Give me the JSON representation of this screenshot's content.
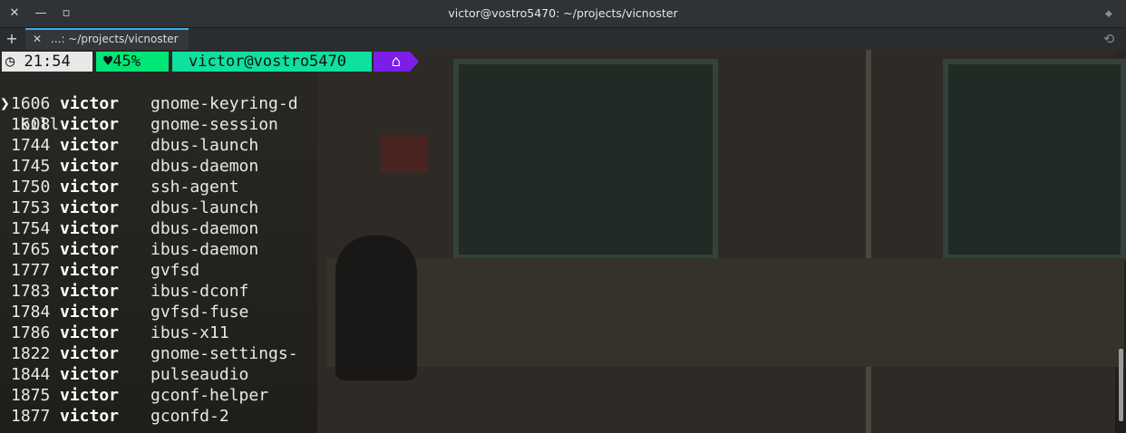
{
  "window": {
    "title": "victor@vostro5470: ~/projects/vicnoster",
    "close_glyph": "✕",
    "minimize_glyph": "—",
    "maximize_glyph": "▫",
    "menu_glyph": "⌖"
  },
  "tabs": {
    "new_tab_glyph": "+",
    "items": [
      {
        "label": "...: ~/projects/vicnoster",
        "close_glyph": "✕"
      }
    ],
    "history_glyph": "⟲"
  },
  "prompt": {
    "clock_glyph": "◷",
    "time": "21:54",
    "heart_glyph": "♥",
    "battery": "45%",
    "user_host": "victor@vostro5470",
    "home_glyph": "⌂",
    "colors": {
      "time": "#e8e8e8",
      "battery": "#00e676",
      "user_host": "#0ee0a0",
      "home": "#7a1ee8"
    }
  },
  "command": {
    "arrow": "❯",
    "text": "kill"
  },
  "processes": [
    {
      "pid": "1606",
      "user": "victor",
      "cmd": "gnome-keyring-d"
    },
    {
      "pid": "1608",
      "user": "victor",
      "cmd": "gnome-session"
    },
    {
      "pid": "1744",
      "user": "victor",
      "cmd": "dbus-launch"
    },
    {
      "pid": "1745",
      "user": "victor",
      "cmd": "dbus-daemon"
    },
    {
      "pid": "1750",
      "user": "victor",
      "cmd": "ssh-agent"
    },
    {
      "pid": "1753",
      "user": "victor",
      "cmd": "dbus-launch"
    },
    {
      "pid": "1754",
      "user": "victor",
      "cmd": "dbus-daemon"
    },
    {
      "pid": "1765",
      "user": "victor",
      "cmd": "ibus-daemon"
    },
    {
      "pid": "1777",
      "user": "victor",
      "cmd": "gvfsd"
    },
    {
      "pid": "1783",
      "user": "victor",
      "cmd": "ibus-dconf"
    },
    {
      "pid": "1784",
      "user": "victor",
      "cmd": "gvfsd-fuse"
    },
    {
      "pid": "1786",
      "user": "victor",
      "cmd": "ibus-x11"
    },
    {
      "pid": "1822",
      "user": "victor",
      "cmd": "gnome-settings-"
    },
    {
      "pid": "1844",
      "user": "victor",
      "cmd": "pulseaudio"
    },
    {
      "pid": "1875",
      "user": "victor",
      "cmd": "gconf-helper"
    },
    {
      "pid": "1877",
      "user": "victor",
      "cmd": "gconfd-2"
    }
  ]
}
